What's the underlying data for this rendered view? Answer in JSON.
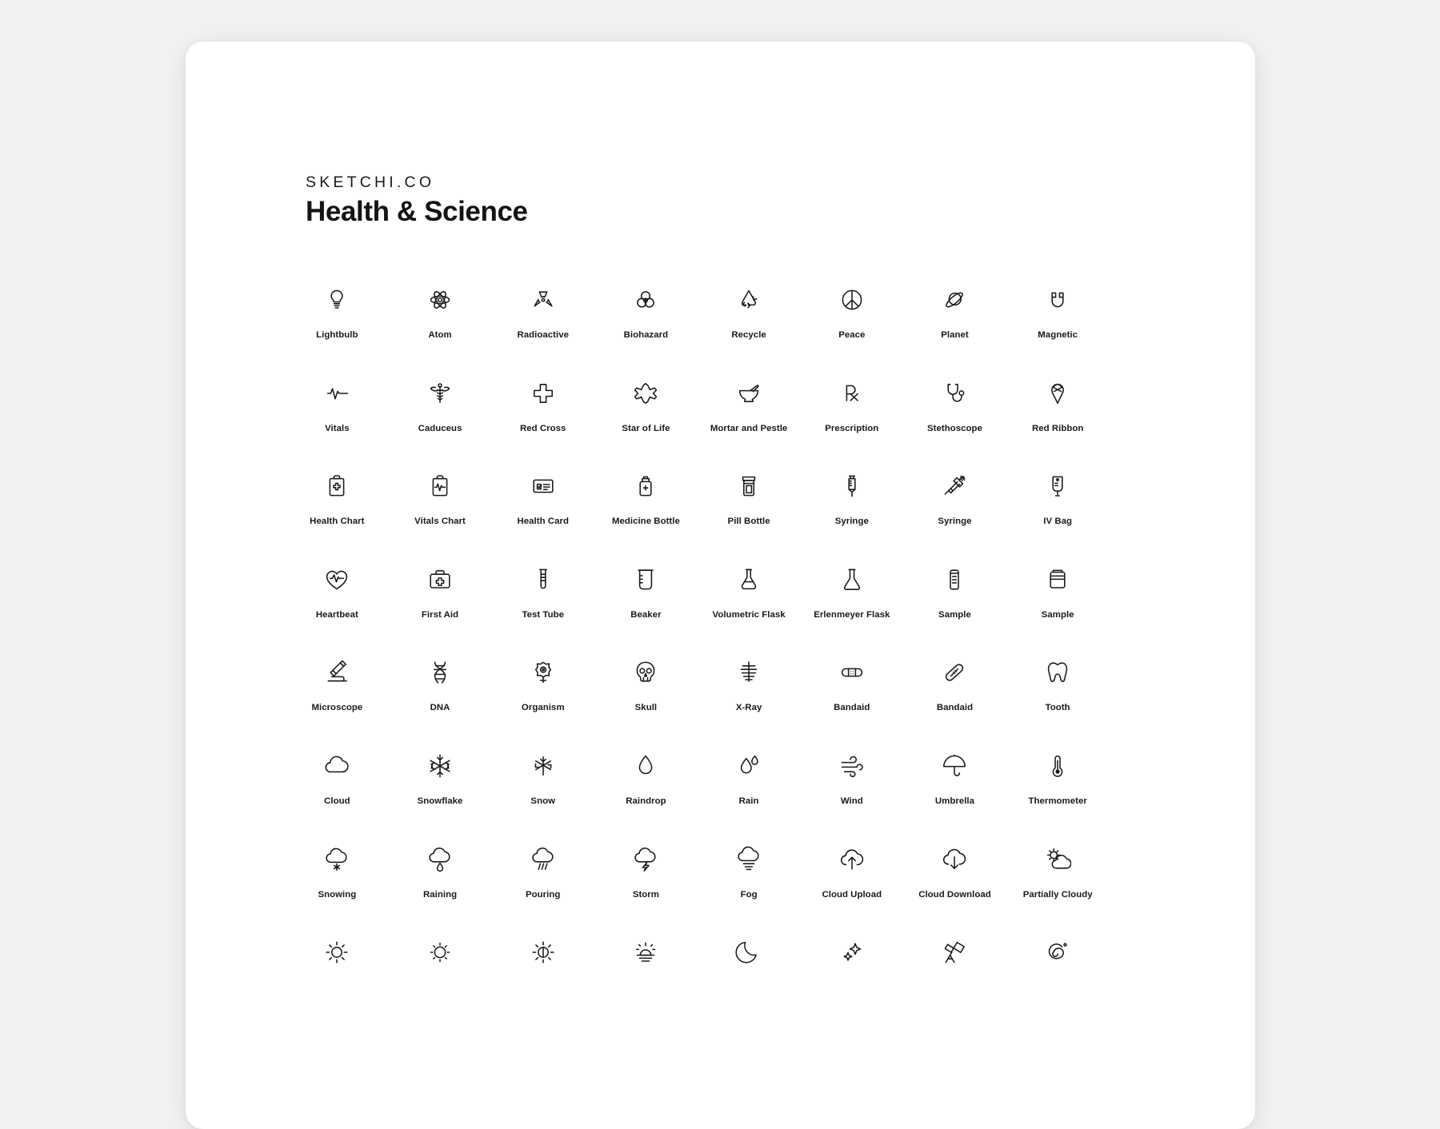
{
  "header": {
    "brand": "SKETCHI.CO",
    "title": "Health & Science"
  },
  "colors": {
    "page_background": "#f2f2f2",
    "sheet_background": "#ffffff",
    "icon_stroke": "#1a1a1a",
    "text": "#1a1a1a"
  },
  "grid": {
    "columns": 8,
    "icons": [
      {
        "label": "Lightbulb",
        "icon": "lightbulb-icon"
      },
      {
        "label": "Atom",
        "icon": "atom-icon"
      },
      {
        "label": "Radioactive",
        "icon": "radioactive-icon"
      },
      {
        "label": "Biohazard",
        "icon": "biohazard-icon"
      },
      {
        "label": "Recycle",
        "icon": "recycle-icon"
      },
      {
        "label": "Peace",
        "icon": "peace-icon"
      },
      {
        "label": "Planet",
        "icon": "planet-icon"
      },
      {
        "label": "Magnetic",
        "icon": "magnet-icon"
      },
      {
        "label": "Vitals",
        "icon": "vitals-icon"
      },
      {
        "label": "Caduceus",
        "icon": "caduceus-icon"
      },
      {
        "label": "Red Cross",
        "icon": "red-cross-icon"
      },
      {
        "label": "Star of Life",
        "icon": "star-of-life-icon"
      },
      {
        "label": "Mortar and Pestle",
        "icon": "mortar-pestle-icon"
      },
      {
        "label": "Prescription",
        "icon": "prescription-rx-icon"
      },
      {
        "label": "Stethoscope",
        "icon": "stethoscope-icon"
      },
      {
        "label": "Red Ribbon",
        "icon": "ribbon-icon"
      },
      {
        "label": "Health Chart",
        "icon": "health-chart-icon"
      },
      {
        "label": "Vitals Chart",
        "icon": "vitals-chart-icon"
      },
      {
        "label": "Health Card",
        "icon": "health-card-icon"
      },
      {
        "label": "Medicine Bottle",
        "icon": "medicine-bottle-icon"
      },
      {
        "label": "Pill Bottle",
        "icon": "pill-bottle-icon"
      },
      {
        "label": "Syringe",
        "icon": "syringe-upright-icon"
      },
      {
        "label": "Syringe",
        "icon": "syringe-diagonal-icon"
      },
      {
        "label": "IV Bag",
        "icon": "iv-bag-icon"
      },
      {
        "label": "Heartbeat",
        "icon": "heartbeat-icon"
      },
      {
        "label": "First Aid",
        "icon": "first-aid-kit-icon"
      },
      {
        "label": "Test Tube",
        "icon": "test-tube-icon"
      },
      {
        "label": "Beaker",
        "icon": "beaker-icon"
      },
      {
        "label": "Volumetric Flask",
        "icon": "volumetric-flask-icon"
      },
      {
        "label": "Erlenmeyer Flask",
        "icon": "erlenmeyer-flask-icon"
      },
      {
        "label": "Sample",
        "icon": "sample-vial-icon"
      },
      {
        "label": "Sample",
        "icon": "sample-jar-icon"
      },
      {
        "label": "Microscope",
        "icon": "microscope-icon"
      },
      {
        "label": "DNA",
        "icon": "dna-icon"
      },
      {
        "label": "Organism",
        "icon": "organism-icon"
      },
      {
        "label": "Skull",
        "icon": "skull-icon"
      },
      {
        "label": "X-Ray",
        "icon": "xray-ribcage-icon"
      },
      {
        "label": "Bandaid",
        "icon": "bandaid-horizontal-icon"
      },
      {
        "label": "Bandaid",
        "icon": "bandaid-diagonal-icon"
      },
      {
        "label": "Tooth",
        "icon": "tooth-icon"
      },
      {
        "label": "Cloud",
        "icon": "cloud-icon"
      },
      {
        "label": "Snowflake",
        "icon": "snowflake-icon"
      },
      {
        "label": "Snow",
        "icon": "snow-icon"
      },
      {
        "label": "Raindrop",
        "icon": "raindrop-icon"
      },
      {
        "label": "Rain",
        "icon": "rain-icon"
      },
      {
        "label": "Wind",
        "icon": "wind-icon"
      },
      {
        "label": "Umbrella",
        "icon": "umbrella-icon"
      },
      {
        "label": "Thermometer",
        "icon": "thermometer-icon"
      },
      {
        "label": "Snowing",
        "icon": "cloud-snowing-icon"
      },
      {
        "label": "Raining",
        "icon": "cloud-raining-icon"
      },
      {
        "label": "Pouring",
        "icon": "cloud-pouring-icon"
      },
      {
        "label": "Storm",
        "icon": "cloud-storm-icon"
      },
      {
        "label": "Fog",
        "icon": "cloud-fog-icon"
      },
      {
        "label": "Cloud Upload",
        "icon": "cloud-upload-icon"
      },
      {
        "label": "Cloud Download",
        "icon": "cloud-download-icon"
      },
      {
        "label": "Partially Cloudy",
        "icon": "partially-cloudy-icon"
      },
      {
        "label": "",
        "icon": "sun-icon"
      },
      {
        "label": "",
        "icon": "sun-outline-icon"
      },
      {
        "label": "",
        "icon": "sun-half-icon"
      },
      {
        "label": "",
        "icon": "sunset-icon"
      },
      {
        "label": "",
        "icon": "moon-icon"
      },
      {
        "label": "",
        "icon": "sparkle-stars-icon"
      },
      {
        "label": "",
        "icon": "telescope-icon"
      },
      {
        "label": "",
        "icon": "spiral-galaxy-icon"
      }
    ]
  }
}
